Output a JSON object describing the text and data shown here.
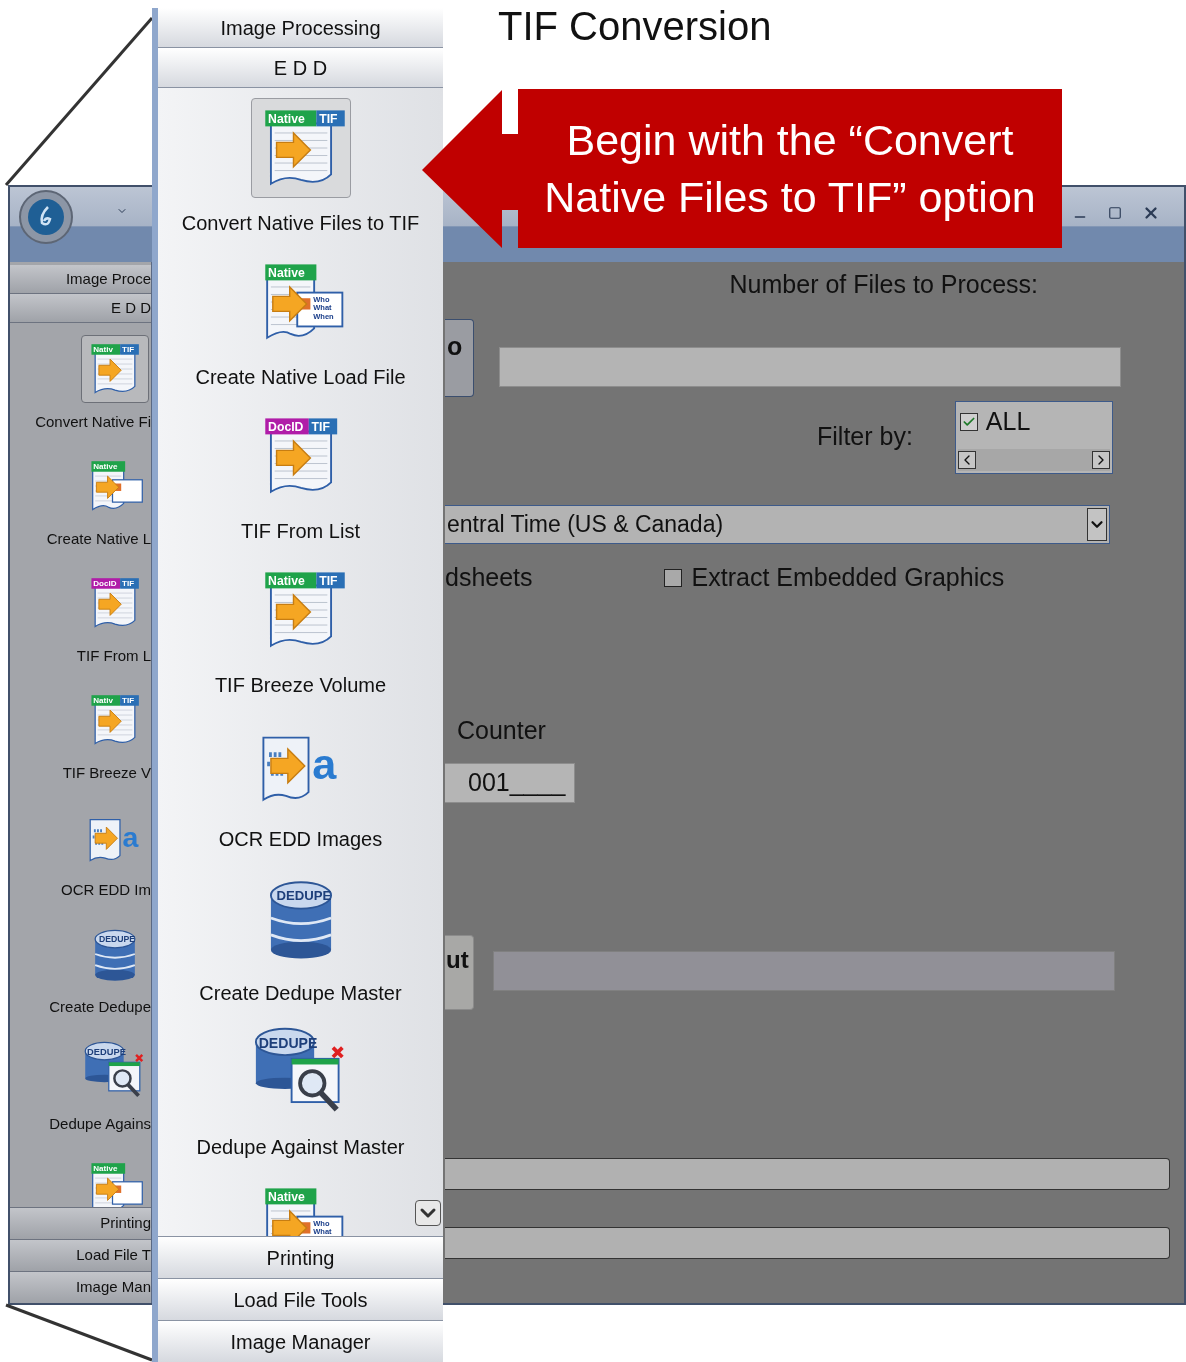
{
  "slide_title": "TIF Conversion",
  "callout": {
    "text": "Begin with the “Convert Native Files to TIF” option"
  },
  "app": {
    "sidebar": {
      "headers_top": [
        "Image Proce",
        "E D D"
      ],
      "items": [
        {
          "label": "Convert Native Fi",
          "kind": "doc",
          "selected": true,
          "tags": [
            {
              "text": "Nativ",
              "color": "#1fa34a"
            },
            {
              "text": "TIF",
              "color": "#2a6fb5"
            }
          ]
        },
        {
          "label": "Create Native L",
          "kind": "load",
          "selected": false,
          "tags": [
            {
              "text": "Native",
              "color": "#1fa34a"
            }
          ]
        },
        {
          "label": "TIF From L",
          "kind": "doc",
          "selected": false,
          "tags": [
            {
              "text": "DocID",
              "color": "#b01ca8"
            },
            {
              "text": "TIF",
              "color": "#2a6fb5"
            }
          ]
        },
        {
          "label": "TIF Breeze V",
          "kind": "doc",
          "selected": false,
          "tags": [
            {
              "text": "Nativ",
              "color": "#1fa34a"
            },
            {
              "text": "TIF",
              "color": "#2a6fb5"
            }
          ]
        },
        {
          "label": "OCR EDD Im",
          "kind": "ocr",
          "selected": false,
          "tags": [
            {
              "text": "a",
              "color": "#2a7bd0"
            }
          ]
        },
        {
          "label": "Create Dedupe",
          "kind": "dedupe",
          "selected": false,
          "tags": [
            {
              "text": "DEDUPE",
              "color": "#1e3f7a"
            }
          ]
        },
        {
          "label": "Dedupe Agains",
          "kind": "dedupe_against",
          "selected": false,
          "tags": [
            {
              "text": "DEDUPE",
              "color": "#1e3f7a"
            }
          ]
        },
        {
          "kind": "load",
          "selected": false,
          "tags": [
            {
              "text": "Native",
              "color": "#1fa34a"
            }
          ]
        }
      ],
      "headers_bottom": [
        "Printing",
        "Load File T",
        "Image Man"
      ]
    },
    "form": {
      "files_label": "Number of Files to Process:",
      "button_1": "o",
      "filter_label": "Filter by:",
      "filter_list": [
        {
          "label": "ALL",
          "checked": true
        }
      ],
      "timezone": "entral Time (US & Canada)",
      "option_1": {
        "label": "dsheets"
      },
      "option_2": {
        "label": "Extract Embedded Graphics",
        "checked": false
      },
      "counter_label": "Counter",
      "counter_value": "001____",
      "button_2": "ut"
    }
  },
  "zoom_panel": {
    "headers_top": [
      "Image Processing",
      "E D D"
    ],
    "items": [
      {
        "label": "Convert Native Files to TIF",
        "kind": "doc",
        "selected": true,
        "tags": [
          {
            "text": "Native",
            "color": "#1fa34a"
          },
          {
            "text": "TIF",
            "color": "#2a6fb5"
          }
        ]
      },
      {
        "label": "Create Native Load File",
        "kind": "load",
        "selected": false,
        "tags": [
          {
            "text": "Native",
            "color": "#1fa34a"
          }
        ],
        "mini": [
          "Who",
          "What",
          "When"
        ]
      },
      {
        "label": "TIF From List",
        "kind": "doc",
        "selected": false,
        "tags": [
          {
            "text": "DocID",
            "color": "#b01ca8"
          },
          {
            "text": "TIF",
            "color": "#2a6fb5"
          }
        ]
      },
      {
        "label": "TIF Breeze Volume",
        "kind": "doc",
        "selected": false,
        "tags": [
          {
            "text": "Native",
            "color": "#1fa34a"
          },
          {
            "text": "TIF",
            "color": "#2a6fb5"
          }
        ]
      },
      {
        "label": "OCR EDD Images",
        "kind": "ocr",
        "selected": false,
        "tags": [
          {
            "text": "a",
            "color": "#2a7bd0"
          }
        ]
      },
      {
        "label": "Create Dedupe Master",
        "kind": "dedupe",
        "selected": false,
        "tags": [
          {
            "text": "DEDUPE",
            "color": "#1e3f7a"
          }
        ]
      },
      {
        "label": "Dedupe Against Master",
        "kind": "dedupe_against",
        "selected": false,
        "tags": [
          {
            "text": "DEDUPE",
            "color": "#1e3f7a"
          }
        ]
      },
      {
        "kind": "load",
        "selected": false,
        "tags": [
          {
            "text": "Native",
            "color": "#1fa34a"
          }
        ],
        "mini": [
          "Who",
          "What"
        ]
      }
    ],
    "headers_bottom": [
      "Printing",
      "Load File Tools",
      "Image Manager"
    ]
  }
}
